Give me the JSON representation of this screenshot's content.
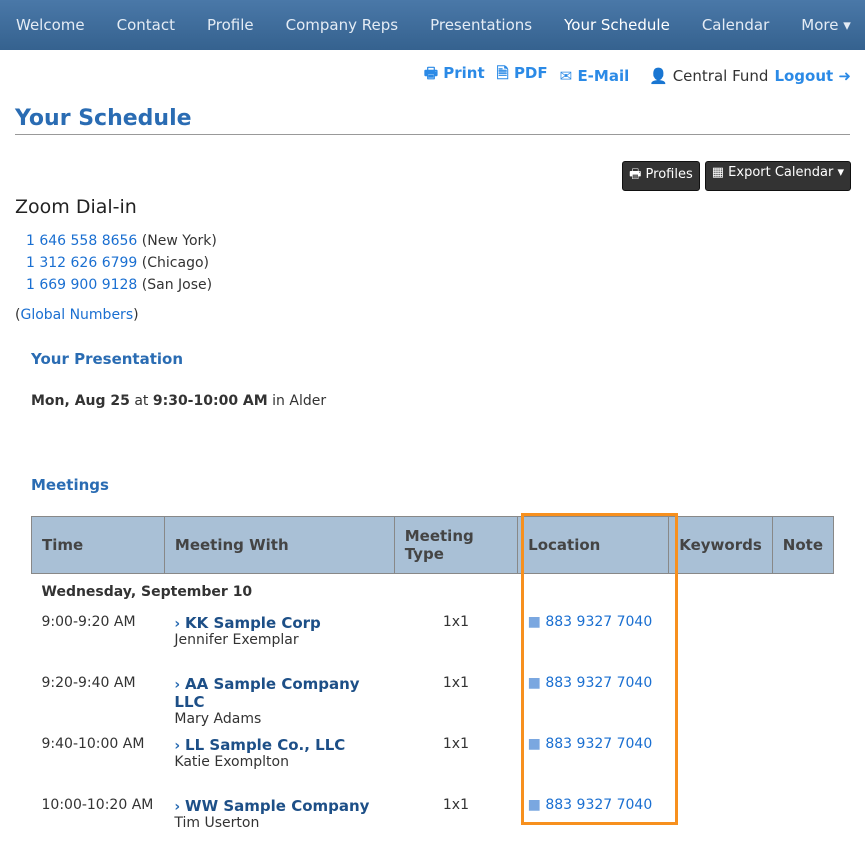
{
  "nav": [
    "Welcome",
    "Contact",
    "Profile",
    "Company Reps",
    "Presentations",
    "Your Schedule",
    "Calendar",
    "More ▾"
  ],
  "top": {
    "print": "Print",
    "pdf": "PDF",
    "email": "E-Mail",
    "user": "Central Fund",
    "logout": "Logout"
  },
  "title": "Your Schedule",
  "buttons": {
    "profiles": "Profiles",
    "export": "Export Calendar"
  },
  "zoom": {
    "heading": "Zoom Dial-in",
    "phones": [
      {
        "n": "1 646 558 8656",
        "c": "(New York)"
      },
      {
        "n": "1 312 626 6799",
        "c": "(Chicago)"
      },
      {
        "n": "1 669 900 9128",
        "c": "(San Jose)"
      }
    ],
    "global": "Global Numbers"
  },
  "presentation": {
    "heading": "Your Presentation",
    "date": "Mon, Aug 25",
    "at": " at ",
    "time": "9:30-10:00 AM",
    "in": " in Alder"
  },
  "meetings": {
    "heading": "Meetings",
    "columns": [
      "Time",
      "Meeting With",
      "Meeting Type",
      "Location",
      "Keywords",
      "Note"
    ],
    "day": "Wednesday, September 10",
    "rows": [
      {
        "time": "9:00-9:20 AM",
        "company": "KK Sample Corp",
        "person": "Jennifer Exemplar",
        "type": "1x1",
        "loc": "883 9327 7040"
      },
      {
        "time": "9:20-9:40 AM",
        "company": "AA Sample Company LLC",
        "person": "Mary Adams",
        "type": "1x1",
        "loc": "883 9327 7040"
      },
      {
        "time": "9:40-10:00 AM",
        "company": "LL Sample Co., LLC",
        "person": "Katie Exomplton",
        "type": "1x1",
        "loc": "883 9327 7040"
      },
      {
        "time": "10:00-10:20 AM",
        "company": "WW Sample Company",
        "person": "Tim Userton",
        "type": "1x1",
        "loc": "883 9327 7040"
      }
    ]
  }
}
